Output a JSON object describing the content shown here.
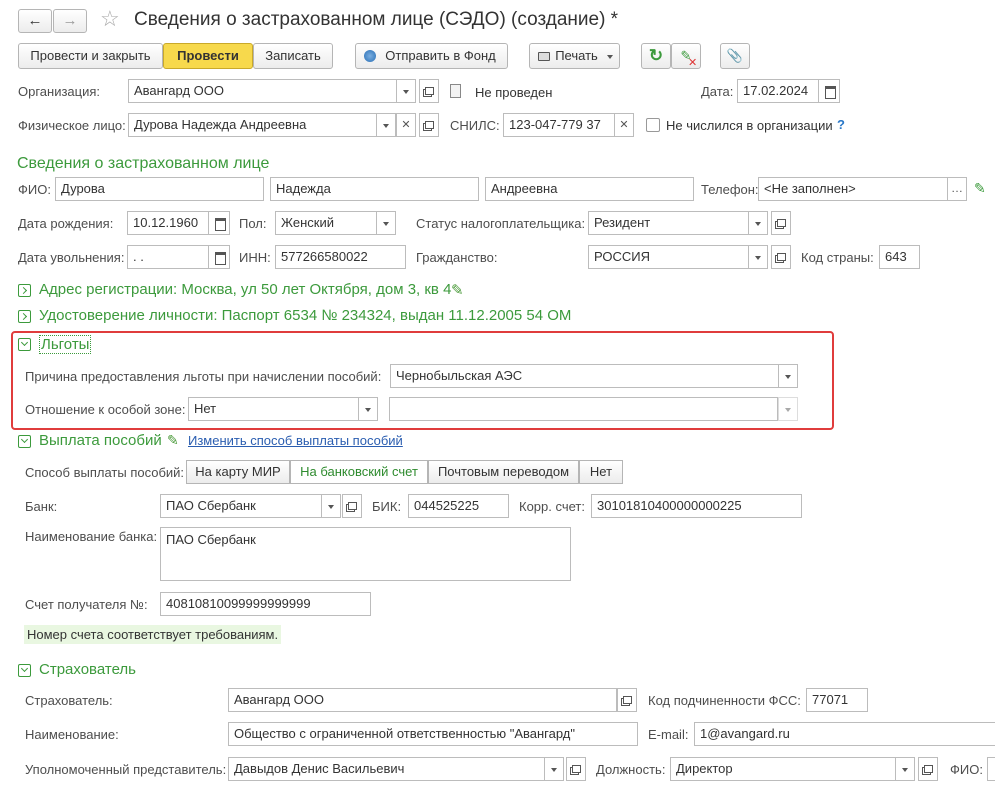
{
  "header": {
    "title": "Сведения о застрахованном лице (СЭДО) (создание) *",
    "star": "☆",
    "modified_mark": ""
  },
  "toolbar": {
    "post_close": "Провести и закрыть",
    "post": "Провести",
    "save": "Записать",
    "send": "Отправить в Фонд",
    "print": "Печать",
    "refresh_icon": "↻",
    "clip_icon": "📎"
  },
  "doc": {
    "org_label": "Организация:",
    "org_value": "Авангард ООО",
    "status": "Не проведен",
    "date_label": "Дата:",
    "date_value": "17.02.2024",
    "person_label": "Физическое лицо:",
    "person_value": "Дурова Надежда Андреевна",
    "snils_label": "СНИЛС:",
    "snils_value": "123-047-779 37",
    "not_listed_label": "Не числился в организации",
    "help": "?"
  },
  "insured": {
    "header": "Сведения о застрахованном лице",
    "fio_label": "ФИО:",
    "last": "Дурова",
    "first": "Надежда",
    "middle": "Андреевна",
    "phone_label": "Телефон:",
    "phone_value": "<Не заполнен>",
    "birth_label": "Дата рождения:",
    "birth_value": "10.12.1960",
    "sex_label": "Пол:",
    "sex_value": "Женский",
    "tax_status_label": "Статус налогоплательщика:",
    "tax_status_value": "Резидент",
    "dismissal_label": "Дата увольнения:",
    "dismissal_value": " .  .",
    "inn_label": "ИНН:",
    "inn_value": "577266580022",
    "citizenship_label": "Гражданство:",
    "citizenship_value": "РОССИЯ",
    "country_code_label": "Код страны:",
    "country_code_value": "643"
  },
  "address": {
    "text": "Адрес регистрации: Москва, ул 50 лет Октября, дом 3, кв 4"
  },
  "identity": {
    "text": "Удостоверение личности: Паспорт 6534 № 234324, выдан 11.12.2005 54 ОМ"
  },
  "benefits": {
    "header": "Льготы",
    "reason_label": "Причина предоставления льготы при начислении пособий:",
    "reason_value": "Чернобыльская АЭС",
    "zone_label": "Отношение к особой зоне:",
    "zone_value": "Нет",
    "zone_extra_value": ""
  },
  "payment": {
    "header": "Выплата пособий",
    "change_link": "Изменить способ выплаты пособий",
    "method_label": "Способ выплаты пособий:",
    "methods": [
      "На карту МИР",
      "На банковский счет",
      "Почтовым переводом",
      "Нет"
    ],
    "selected_method": "На банковский счет",
    "bank_label": "Банк:",
    "bank_value": "ПАО Сбербанк",
    "bik_label": "БИК:",
    "bik_value": "044525225",
    "corr_label": "Корр. счет:",
    "corr_value": "30101810400000000225",
    "bank_name_label": "Наименование банка:",
    "bank_name_value": "ПАО Сбербанк",
    "account_label": "Счет получателя №:",
    "account_value": "40810810099999999999",
    "account_msg": "Номер счета соответствует требованиям."
  },
  "insurer": {
    "header": "Страхователь",
    "insurer_label": "Страхователь:",
    "insurer_value": "Авангард ООО",
    "fss_code_label": "Код подчиненности ФСС:",
    "fss_code_value": "77071",
    "name_label": "Наименование:",
    "name_value": "Общество с ограниченной ответственностью \"Авангард\"",
    "email_label": "E-mail:",
    "email_value": "1@avangard.ru",
    "rep_label": "Уполномоченный представитель:",
    "rep_value": "Давыдов Денис Васильевич",
    "position_label": "Должность:",
    "position_value": "Директор",
    "fio_label": "ФИО:"
  },
  "colors": {
    "accent_green": "#3c9a3c",
    "highlight_red": "#e03c3c",
    "primary_button": "#f7d94c"
  }
}
